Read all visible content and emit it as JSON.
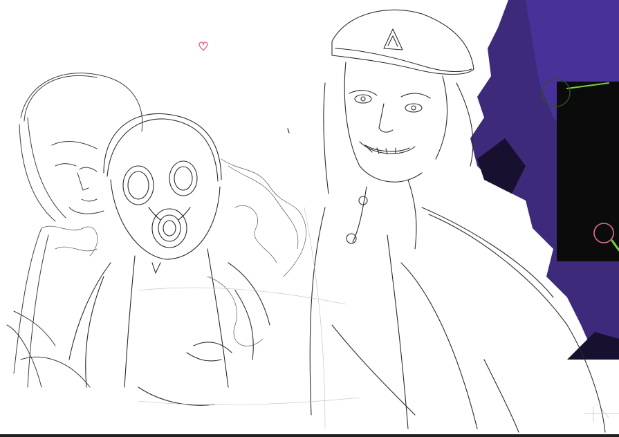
{
  "canvas": {
    "background": "#ffffff",
    "sketch_color": "#2a2a2a",
    "paint_primary": "#3d2a7a",
    "paint_dark": "#17102e",
    "paint_black": "#0b0b0b",
    "accent_pink": "#e0708f",
    "accent_green": "#7ad143"
  },
  "icons": [
    "heart-doodle-icon",
    "brush-cursor-icon",
    "color-picker-ring-icon"
  ]
}
